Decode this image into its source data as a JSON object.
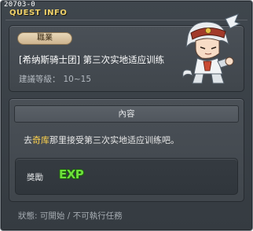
{
  "quest": {
    "id": "20703-0",
    "window_title": "QUEST INFO",
    "job_label": "職業",
    "name": "[希纳斯骑士团] 第三次实地适应训练",
    "level_label": "建議等級：",
    "level_value": "10~15"
  },
  "content": {
    "header": "內容",
    "desc_prefix": "去",
    "desc_highlight": "奇库",
    "desc_suffix": "那里接受第三次实地适应训练吧。"
  },
  "reward": {
    "label": "獎勵",
    "exp_text": "EXP"
  },
  "status": {
    "text": "狀態: 可開始 / 不可執行任務"
  },
  "npc": {
    "icon": "npc-sprite-white-haired-knight"
  },
  "colors": {
    "title": "#f0d26a",
    "highlight": "#ffd34d",
    "exp": "#6ce03a"
  }
}
